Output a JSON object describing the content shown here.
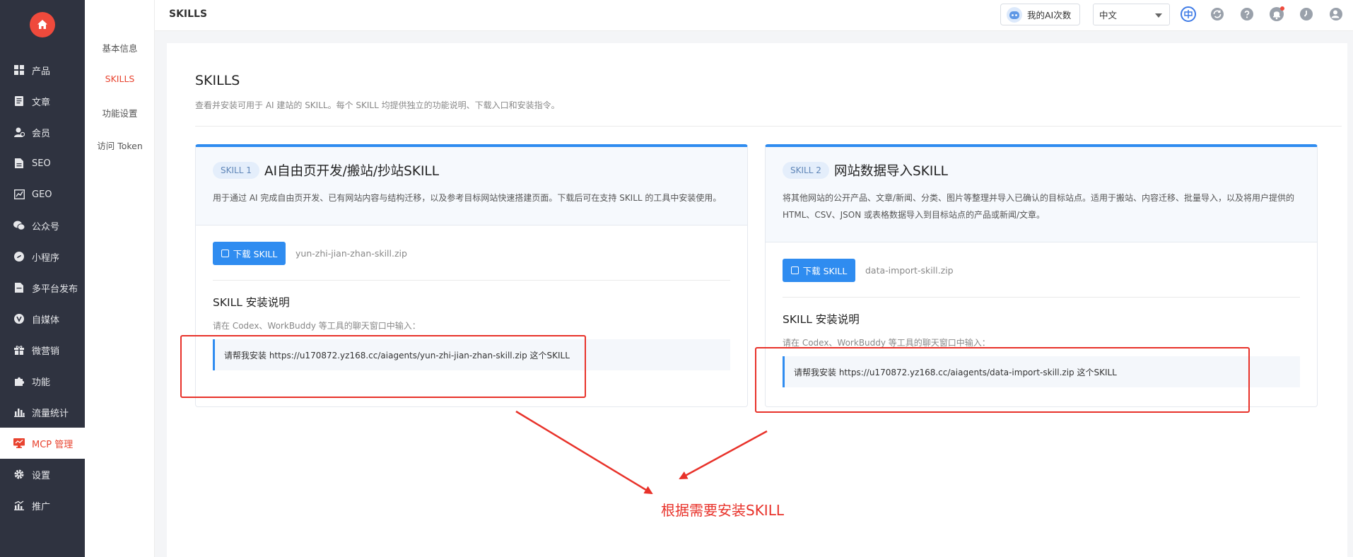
{
  "sidebar": {
    "items": [
      {
        "label": "产品",
        "icon": "grid-icon"
      },
      {
        "label": "文章",
        "icon": "document-icon"
      },
      {
        "label": "会员",
        "icon": "member-icon"
      },
      {
        "label": "SEO",
        "icon": "seo-file-icon"
      },
      {
        "label": "GEO",
        "icon": "chart-icon"
      },
      {
        "label": "公众号",
        "icon": "wechat-icon"
      },
      {
        "label": "小程序",
        "icon": "miniprogram-icon"
      },
      {
        "label": "多平台发布",
        "icon": "publish-icon"
      },
      {
        "label": "自媒体",
        "icon": "media-icon"
      },
      {
        "label": "微营销",
        "icon": "gift-icon"
      },
      {
        "label": "功能",
        "icon": "puzzle-icon"
      },
      {
        "label": "流量统计",
        "icon": "bar-chart-icon"
      },
      {
        "label": "MCP 管理",
        "icon": "monitor-icon"
      },
      {
        "label": "设置",
        "icon": "gear-icon"
      },
      {
        "label": "推广",
        "icon": "promote-icon"
      }
    ],
    "active": "MCP 管理"
  },
  "subnav": {
    "items": [
      "基本信息",
      "SKILLS",
      "功能设置",
      "访问 Token"
    ],
    "active": "SKILLS"
  },
  "topbar": {
    "title": "SKILLS",
    "ai_button": "我的AI次数",
    "language": "中文"
  },
  "page": {
    "title": "SKILLS",
    "description": "查看并安装可用于 AI 建站的 SKILL。每个 SKILL 均提供独立的功能说明、下载入口和安装指令。"
  },
  "cards": [
    {
      "badge": "SKILL 1",
      "name": "AI自由页开发/搬站/抄站SKILL",
      "desc_lines": [
        "用于通过 AI 完成自由页开发、已有网站内容与结构迁移，以及参考目标网站快速搭建页面。下载后可在支持 SKILL 的工具中安装使用。"
      ],
      "download_label": "下载 SKILL",
      "zip": "yun-zhi-jian-zhan-skill.zip",
      "install_title": "SKILL 安装说明",
      "install_desc": "请在 Codex、WorkBuddy 等工具的聊天窗口中输入：",
      "command": "请帮我安装 https://u170872.yz168.cc/aiagents/yun-zhi-jian-zhan-skill.zip 这个SKILL"
    },
    {
      "badge": "SKILL 2",
      "name": "网站数据导入SKILL",
      "desc_lines": [
        "将其他网站的公开产品、文章/新闻、分类、图片等整理并导入已确认的目标站点。适用于搬站、内容迁移、批量导入，以及将用户提供的",
        "HTML、CSV、JSON 或表格数据导入到目标站点的产品或新闻/文章。"
      ],
      "download_label": "下载 SKILL",
      "zip": "data-import-skill.zip",
      "install_title": "SKILL 安装说明",
      "install_desc": "请在 Codex、WorkBuddy 等工具的聊天窗口中输入：",
      "command": "请帮我安装 https://u170872.yz168.cc/aiagents/data-import-skill.zip 这个SKILL"
    }
  ],
  "annotation": {
    "text": "根据需要安装SKILL",
    "color": "#e8322a"
  },
  "colors": {
    "accent": "#2f8cf0",
    "active": "#e8432f",
    "sidebar_bg": "#2f3340"
  }
}
